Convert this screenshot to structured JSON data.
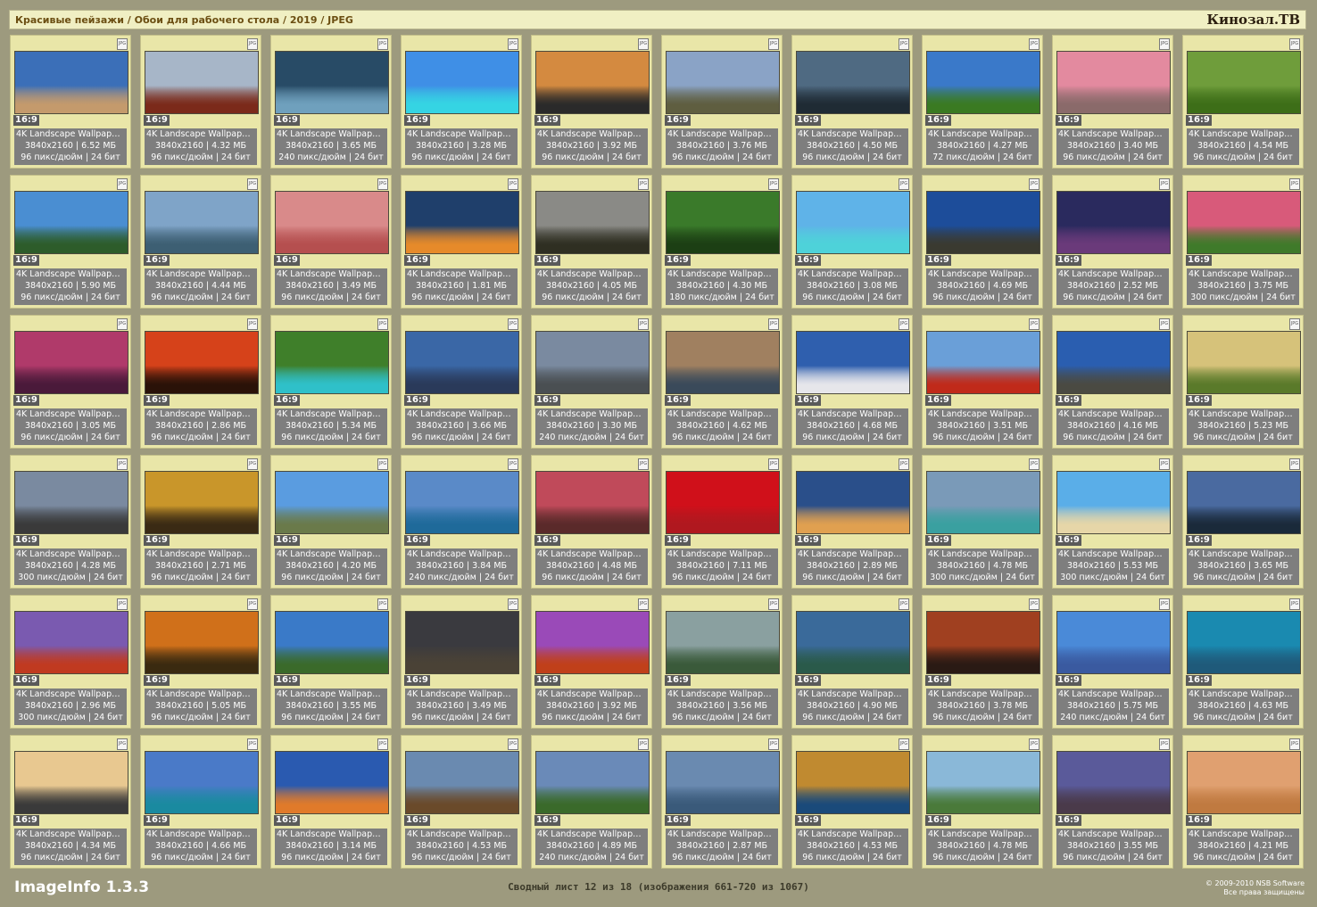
{
  "header": {
    "title": "Красивые пейзажи / Обои для рабочего стола / 2019 / JPEG",
    "brand": "Кинозал.ТВ"
  },
  "tile_common": {
    "badge_icon": "jpg-file-icon",
    "badge_text": "JPG",
    "ratio": "16:9",
    "title": "4K Landscape Wallpape…"
  },
  "thumbs": [
    {
      "title": "4K Landscape Wallpape…",
      "size": "3840x2160 | 6.52 МБ",
      "dpi": "96 пикс/дюйм | 24 бит",
      "sky": "#3b6fb8",
      "land": "#c49a6c"
    },
    {
      "title": "4K Landscape Wallpape…",
      "size": "3840x2160 | 4.32 МБ",
      "dpi": "96 пикс/дюйм | 24 бит",
      "sky": "#a7b6c8",
      "land": "#7b2a1a"
    },
    {
      "title": "4K Landscape Wallpape…",
      "size": "3840x2160 | 3.65 МБ",
      "dpi": "240 пикс/дюйм | 24 бит",
      "sky": "#284b66",
      "land": "#6fa0bd"
    },
    {
      "title": "4K Landscape Wallpape…",
      "size": "3840x2160 | 3.28 МБ",
      "dpi": "96 пикс/дюйм | 24 бит",
      "sky": "#3f8fe6",
      "land": "#35d4e3"
    },
    {
      "title": "4K Landscape Wallpape…",
      "size": "3840x2160 | 3.92 МБ",
      "dpi": "96 пикс/дюйм | 24 бит",
      "sky": "#d48a40",
      "land": "#2a2a2a"
    },
    {
      "title": "4K Landscape Wallpape…",
      "size": "3840x2160 | 3.76 МБ",
      "dpi": "96 пикс/дюйм | 24 бит",
      "sky": "#8aa3c6",
      "land": "#5f5e40"
    },
    {
      "title": "4K Landscape Wallpape…",
      "size": "3840x2160 | 4.50 МБ",
      "dpi": "96 пикс/дюйм | 24 бит",
      "sky": "#4f6a82",
      "land": "#1f2b34"
    },
    {
      "title": "4K Landscape Wallpape…",
      "size": "3840x2160 | 4.27 МБ",
      "dpi": "72 пикс/дюйм | 24 бит",
      "sky": "#3a79c9",
      "land": "#3a7a22"
    },
    {
      "title": "4K Landscape Wallpape…",
      "size": "3840x2160 | 3.40 МБ",
      "dpi": "96 пикс/дюйм | 24 бит",
      "sky": "#e38a9f",
      "land": "#8a6a6a"
    },
    {
      "title": "4K Landscape Wallpape…",
      "size": "3840x2160 | 4.54 МБ",
      "dpi": "96 пикс/дюйм | 24 бит",
      "sky": "#6f9d3b",
      "land": "#3d6e18"
    },
    {
      "title": "4K Landscape Wallpape…",
      "size": "3840x2160 | 5.90 МБ",
      "dpi": "96 пикс/дюйм | 24 бит",
      "sky": "#4a8ed2",
      "land": "#2d5c2a"
    },
    {
      "title": "4K Landscape Wallpape…",
      "size": "3840x2160 | 4.44 МБ",
      "dpi": "96 пикс/дюйм | 24 бит",
      "sky": "#7fa4c8",
      "land": "#3d5f73"
    },
    {
      "title": "4K Landscape Wallpape…",
      "size": "3840x2160 | 3.49 МБ",
      "dpi": "96 пикс/дюйм | 24 бит",
      "sky": "#d98a8a",
      "land": "#b54f4f"
    },
    {
      "title": "4K Landscape Wallpape…",
      "size": "3840x2160 | 1.81 МБ",
      "dpi": "96 пикс/дюйм | 24 бит",
      "sky": "#1f3f6b",
      "land": "#e68a2a"
    },
    {
      "title": "4K Landscape Wallpape…",
      "size": "3840x2160 | 4.05 МБ",
      "dpi": "96 пикс/дюйм | 24 бит",
      "sky": "#8a8a86",
      "land": "#2f2f22"
    },
    {
      "title": "4K Landscape Wallpape…",
      "size": "3840x2160 | 4.30 МБ",
      "dpi": "180 пикс/дюйм | 24 бит",
      "sky": "#3a7a2a",
      "land": "#1c3f14"
    },
    {
      "title": "4K Landscape Wallpape…",
      "size": "3840x2160 | 3.08 МБ",
      "dpi": "96 пикс/дюйм | 24 бит",
      "sky": "#5fb3e8",
      "land": "#4ed2d9"
    },
    {
      "title": "4K Landscape Wallpape…",
      "size": "3840x2160 | 4.69 МБ",
      "dpi": "96 пикс/дюйм | 24 бит",
      "sky": "#1d4d9a",
      "land": "#3a3a30"
    },
    {
      "title": "4K Landscape Wallpape…",
      "size": "3840x2160 | 2.52 МБ",
      "dpi": "96 пикс/дюйм | 24 бит",
      "sky": "#2a2a5e",
      "land": "#6a3a7a"
    },
    {
      "title": "4K Landscape Wallpape…",
      "size": "3840x2160 | 3.75 МБ",
      "dpi": "300 пикс/дюйм | 24 бит",
      "sky": "#d85a7a",
      "land": "#3f7a2a"
    },
    {
      "title": "4K Landscape Wallpape…",
      "size": "3840x2160 | 3.05 МБ",
      "dpi": "96 пикс/дюйм | 24 бит",
      "sky": "#b03a6a",
      "land": "#4a1a3a"
    },
    {
      "title": "4K Landscape Wallpape…",
      "size": "3840x2160 | 2.86 МБ",
      "dpi": "96 пикс/дюйм | 24 бит",
      "sky": "#d6421a",
      "land": "#2a1208"
    },
    {
      "title": "4K Landscape Wallpape…",
      "size": "3840x2160 | 5.34 МБ",
      "dpi": "96 пикс/дюйм | 24 бит",
      "sky": "#3f7f2a",
      "land": "#2fc0c9"
    },
    {
      "title": "4K Landscape Wallpape…",
      "size": "3840x2160 | 3.66 МБ",
      "dpi": "96 пикс/дюйм | 24 бит",
      "sky": "#3a67a6",
      "land": "#2a3a5a"
    },
    {
      "title": "4K Landscape Wallpape…",
      "size": "3840x2160 | 3.30 МБ",
      "dpi": "240 пикс/дюйм | 24 бит",
      "sky": "#7a8aa0",
      "land": "#4a4f52"
    },
    {
      "title": "4K Landscape Wallpape…",
      "size": "3840x2160 | 4.62 МБ",
      "dpi": "96 пикс/дюйм | 24 бит",
      "sky": "#a08060",
      "land": "#3a4a5a"
    },
    {
      "title": "4K Landscape Wallpape…",
      "size": "3840x2160 | 4.68 МБ",
      "dpi": "96 пикс/дюйм | 24 бит",
      "sky": "#2f5fae",
      "land": "#e6e6ea"
    },
    {
      "title": "4K Landscape Wallpape…",
      "size": "3840x2160 | 3.51 МБ",
      "dpi": "96 пикс/дюйм | 24 бит",
      "sky": "#6a9fd8",
      "land": "#c02a1a"
    },
    {
      "title": "4K Landscape Wallpape…",
      "size": "3840x2160 | 4.16 МБ",
      "dpi": "96 пикс/дюйм | 24 бит",
      "sky": "#2a5eb0",
      "land": "#4a4a42"
    },
    {
      "title": "4K Landscape Wallpape…",
      "size": "3840x2160 | 5.23 МБ",
      "dpi": "96 пикс/дюйм | 24 бит",
      "sky": "#d6c27a",
      "land": "#5a7a2a"
    },
    {
      "title": "4K Landscape Wallpape…",
      "size": "3840x2160 | 4.28 МБ",
      "dpi": "300 пикс/дюйм | 24 бит",
      "sky": "#7a8aa0",
      "land": "#3a3a3a"
    },
    {
      "title": "4K Landscape Wallpape…",
      "size": "3840x2160 | 2.71 МБ",
      "dpi": "96 пикс/дюйм | 24 бит",
      "sky": "#c9962a",
      "land": "#3a2a14"
    },
    {
      "title": "4K Landscape Wallpape…",
      "size": "3840x2160 | 4.20 МБ",
      "dpi": "96 пикс/дюйм | 24 бит",
      "sky": "#5a9ce0",
      "land": "#6a7a4a"
    },
    {
      "title": "4K Landscape Wallpape…",
      "size": "3840x2160 | 3.84 МБ",
      "dpi": "240 пикс/дюйм | 24 бит",
      "sky": "#5a8ac8",
      "land": "#1f6a9a"
    },
    {
      "title": "4K Landscape Wallpape…",
      "size": "3840x2160 | 4.48 МБ",
      "dpi": "96 пикс/дюйм | 24 бит",
      "sky": "#c04a5a",
      "land": "#5a2a2a"
    },
    {
      "title": "4K Landscape Wallpape…",
      "size": "3840x2160 | 7.11 МБ",
      "dpi": "96 пикс/дюйм | 24 бит",
      "sky": "#d0101a",
      "land": "#b0181f"
    },
    {
      "title": "4K Landscape Wallpape…",
      "size": "3840x2160 | 2.89 МБ",
      "dpi": "96 пикс/дюйм | 24 бит",
      "sky": "#2a4f8a",
      "land": "#e0a050"
    },
    {
      "title": "4K Landscape Wallpape…",
      "size": "3840x2160 | 4.78 МБ",
      "dpi": "300 пикс/дюйм | 24 бит",
      "sky": "#7a9ab8",
      "land": "#3aa0a0"
    },
    {
      "title": "4K Landscape Wallpape…",
      "size": "3840x2160 | 5.53 МБ",
      "dpi": "300 пикс/дюйм | 24 бит",
      "sky": "#5aaee8",
      "land": "#e6d6a8"
    },
    {
      "title": "4K Landscape Wallpape…",
      "size": "3840x2160 | 3.65 МБ",
      "dpi": "96 пикс/дюйм | 24 бит",
      "sky": "#4a6aa0",
      "land": "#1a2a3a"
    },
    {
      "title": "4K Landscape Wallpape…",
      "size": "3840x2160 | 2.96 МБ",
      "dpi": "300 пикс/дюйм | 24 бит",
      "sky": "#7a5ab0",
      "land": "#c03a20"
    },
    {
      "title": "4K Landscape Wallpape…",
      "size": "3840x2160 | 5.05 МБ",
      "dpi": "96 пикс/дюйм | 24 бит",
      "sky": "#d0701a",
      "land": "#3a2a10"
    },
    {
      "title": "4K Landscape Wallpape…",
      "size": "3840x2160 | 3.55 МБ",
      "dpi": "96 пикс/дюйм | 24 бит",
      "sky": "#3a7ac8",
      "land": "#3a6a2a"
    },
    {
      "title": "4K Landscape Wallpape…",
      "size": "3840x2160 | 3.49 МБ",
      "dpi": "96 пикс/дюйм | 24 бит",
      "sky": "#3a3a3f",
      "land": "#4a4236"
    },
    {
      "title": "4K Landscape Wallpape…",
      "size": "3840x2160 | 3.92 МБ",
      "dpi": "96 пикс/дюйм | 24 бит",
      "sky": "#9a4ab8",
      "land": "#c0401a"
    },
    {
      "title": "4K Landscape Wallpape…",
      "size": "3840x2160 | 3.56 МБ",
      "dpi": "96 пикс/дюйм | 24 бит",
      "sky": "#8aa0a0",
      "land": "#3a5a3a"
    },
    {
      "title": "4K Landscape Wallpape…",
      "size": "3840x2160 | 4.90 МБ",
      "dpi": "96 пикс/дюйм | 24 бит",
      "sky": "#3a6a9a",
      "land": "#2a5a4a"
    },
    {
      "title": "4K Landscape Wallpape…",
      "size": "3840x2160 | 3.78 МБ",
      "dpi": "96 пикс/дюйм | 24 бит",
      "sky": "#a04020",
      "land": "#2a1a14"
    },
    {
      "title": "4K Landscape Wallpape…",
      "size": "3840x2160 | 5.75 МБ",
      "dpi": "240 пикс/дюйм | 24 бит",
      "sky": "#4a8ad8",
      "land": "#3a5aa0"
    },
    {
      "title": "4K Landscape Wallpape…",
      "size": "3840x2160 | 4.63 МБ",
      "dpi": "96 пикс/дюйм | 24 бит",
      "sky": "#1a8ab0",
      "land": "#1f5a7a"
    },
    {
      "title": "4K Landscape Wallpape…",
      "size": "3840x2160 | 4.34 МБ",
      "dpi": "96 пикс/дюйм | 24 бит",
      "sky": "#e8c890",
      "land": "#3a3a3a"
    },
    {
      "title": "4K Landscape Wallpape…",
      "size": "3840x2160 | 4.66 МБ",
      "dpi": "96 пикс/дюйм | 24 бит",
      "sky": "#4a7ac8",
      "land": "#1a8aa0"
    },
    {
      "title": "4K Landscape Wallpape…",
      "size": "3840x2160 | 3.14 МБ",
      "dpi": "96 пикс/дюйм | 24 бит",
      "sky": "#2a5ab0",
      "land": "#e07a2a"
    },
    {
      "title": "4K Landscape Wallpape…",
      "size": "3840x2160 | 4.53 МБ",
      "dpi": "96 пикс/дюйм | 24 бит",
      "sky": "#6a8ab0",
      "land": "#6a4a2a"
    },
    {
      "title": "4K Landscape Wallpape…",
      "size": "3840x2160 | 4.89 МБ",
      "dpi": "240 пикс/дюйм | 24 бит",
      "sky": "#6a8ab8",
      "land": "#3a6a2a"
    },
    {
      "title": "4K Landscape Wallpape…",
      "size": "3840x2160 | 2.87 МБ",
      "dpi": "96 пикс/дюйм | 24 бит",
      "sky": "#6a8ab0",
      "land": "#3a5a7a"
    },
    {
      "title": "4K Landscape Wallpape…",
      "size": "3840x2160 | 4.53 МБ",
      "dpi": "96 пикс/дюйм | 24 бит",
      "sky": "#c08a30",
      "land": "#1a4a7a"
    },
    {
      "title": "4K Landscape Wallpape…",
      "size": "3840x2160 | 4.78 МБ",
      "dpi": "96 пикс/дюйм | 24 бит",
      "sky": "#8ab8d8",
      "land": "#4a7a3a"
    },
    {
      "title": "4K Landscape Wallpape…",
      "size": "3840x2160 | 3.55 МБ",
      "dpi": "96 пикс/дюйм | 24 бит",
      "sky": "#5a5a9a",
      "land": "#4a3a4a"
    },
    {
      "title": "4K Landscape Wallpape…",
      "size": "3840x2160 | 4.21 МБ",
      "dpi": "96 пикс/дюйм | 24 бит",
      "sky": "#e0a070",
      "land": "#c07a40"
    }
  ],
  "footer": {
    "app": "ImageInfo 1.3.3",
    "sheet": "Сводный лист 12 из 18 (изображения 661-720 из 1067)",
    "copyright": "© 2009-2010 NSB Software",
    "rights": "Все права защищены"
  }
}
